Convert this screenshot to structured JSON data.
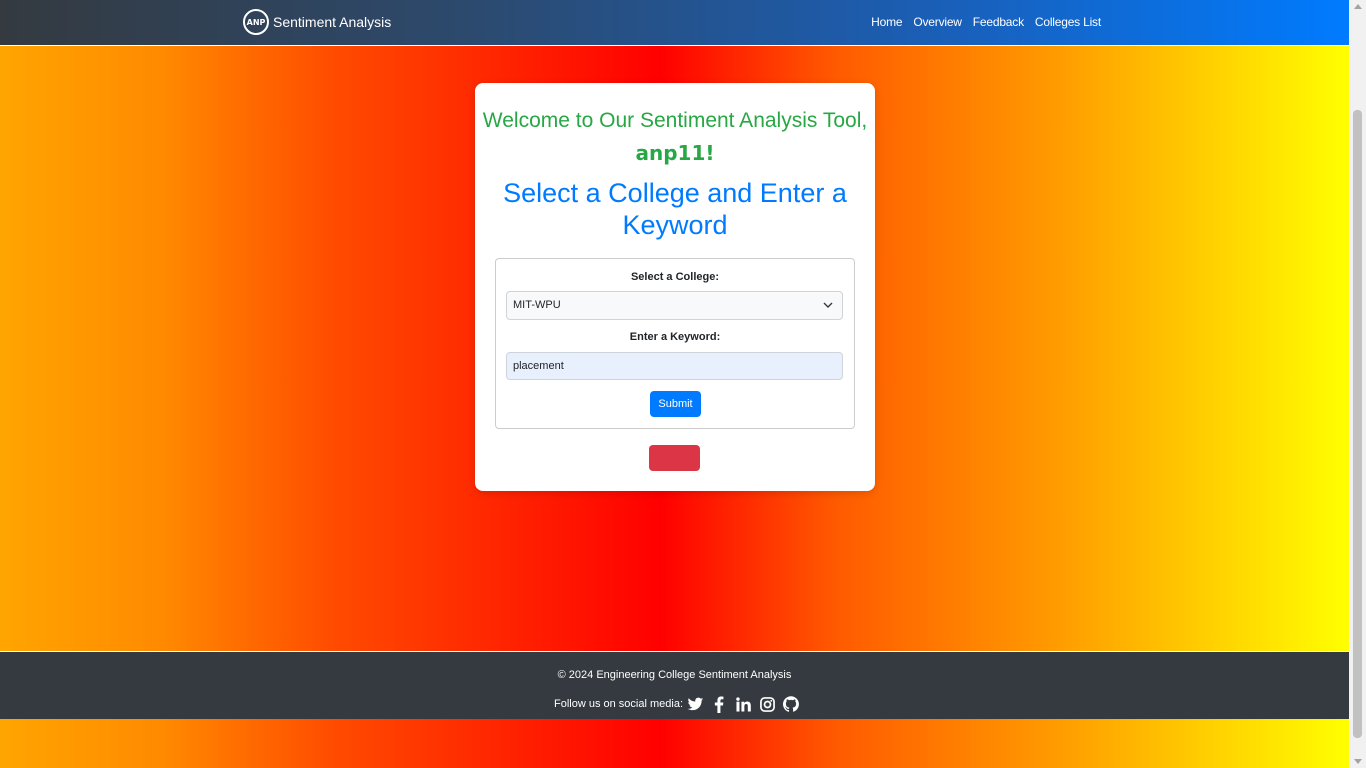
{
  "navbar": {
    "logo_text": "ANP",
    "brand": "Sentiment Analysis",
    "links": [
      "Home",
      "Overview",
      "Feedback",
      "Colleges List"
    ]
  },
  "card": {
    "welcome_prefix": "Welcome to Our Sentiment Analysis Tool,",
    "username": "anp11!",
    "heading": "Select a College and Enter a Keyword",
    "college_label": "Select a College:",
    "college_value": "MIT-WPU",
    "keyword_label": "Enter a Keyword:",
    "keyword_value": "placement",
    "submit_label": "Submit"
  },
  "footer": {
    "copyright": "© 2024 Engineering College Sentiment Analysis",
    "follow_label": "Follow us on social media:",
    "social_icons": [
      "twitter-icon",
      "facebook-icon",
      "linkedin-icon",
      "instagram-icon",
      "github-icon"
    ]
  },
  "colors": {
    "navbar_start": "#343a40",
    "navbar_end": "#007bff",
    "welcome_green": "#28a745",
    "heading_blue": "#007bff",
    "submit_blue": "#007bff",
    "danger_red": "#dc3545",
    "footer_bg": "#343a40"
  }
}
